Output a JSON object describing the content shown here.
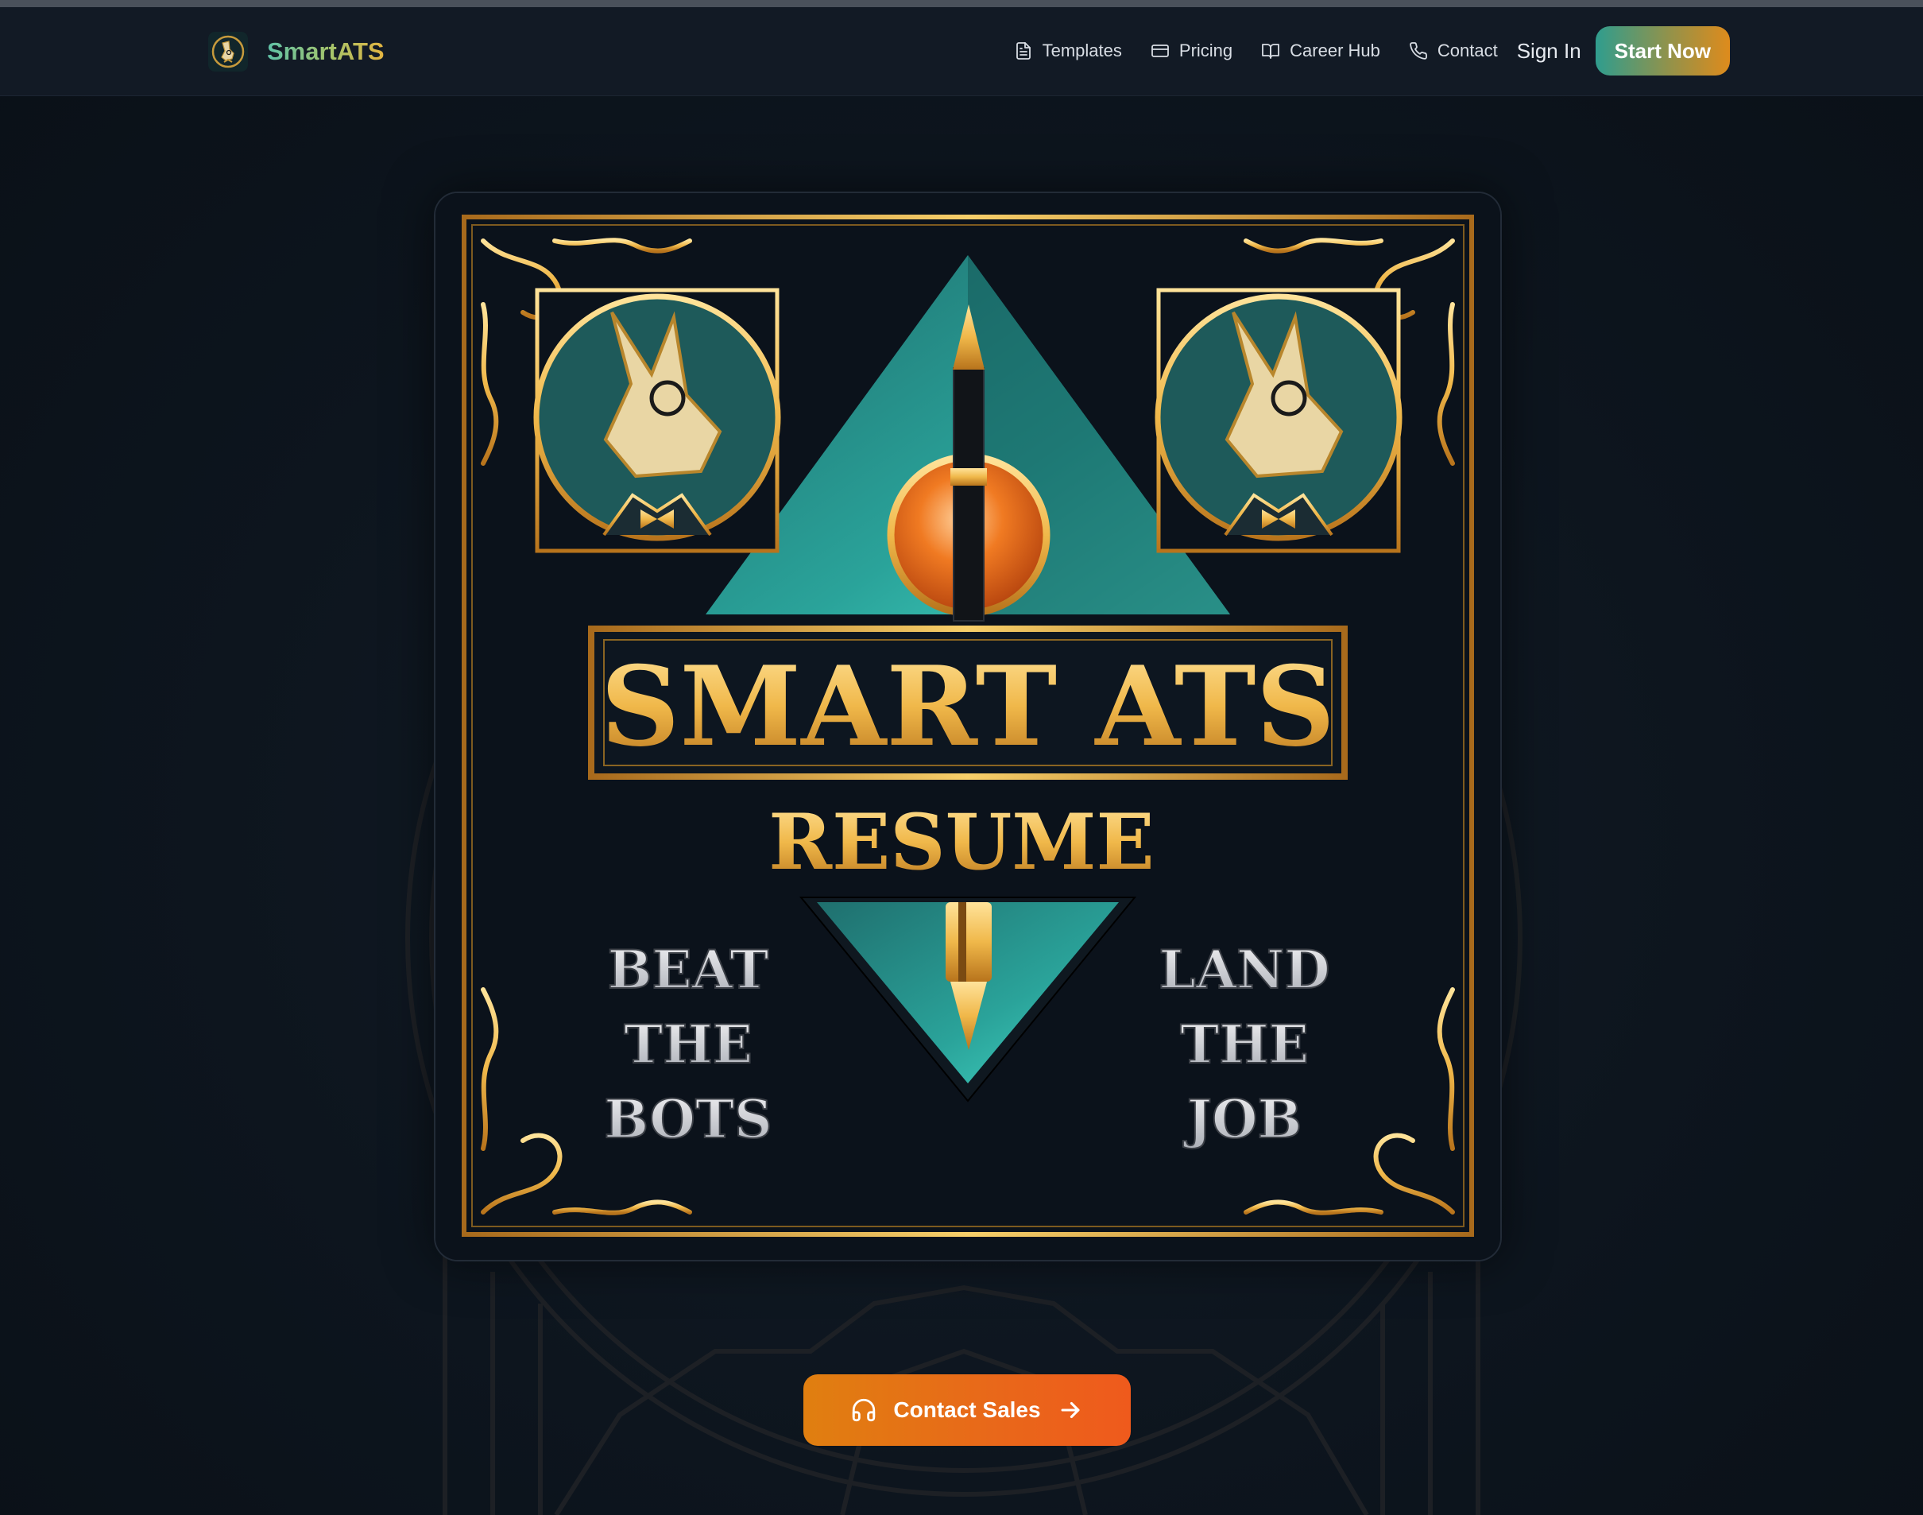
{
  "header": {
    "brand_name": "SmartATS",
    "nav": [
      {
        "label": "Templates",
        "icon": "file-text-icon"
      },
      {
        "label": "Pricing",
        "icon": "credit-card-icon"
      },
      {
        "label": "Career Hub",
        "icon": "book-open-icon"
      },
      {
        "label": "Contact",
        "icon": "phone-icon"
      }
    ],
    "sign_in_label": "Sign In",
    "start_label": "Start Now"
  },
  "hero_image": {
    "title": "SMART ATS",
    "subtitle": "RESUME",
    "left_words": [
      "BEAT",
      "THE",
      "BOTS"
    ],
    "right_words": [
      "LAND",
      "THE",
      "JOB"
    ]
  },
  "cta": {
    "contact_label": "Contact Sales",
    "icon": "headphones-icon",
    "arrow_icon": "arrow-right-icon"
  },
  "colors": {
    "accent_teal": "#2f9d8e",
    "accent_orange": "#e9671a",
    "gold": "#e4b440",
    "background": "#0c141d"
  }
}
